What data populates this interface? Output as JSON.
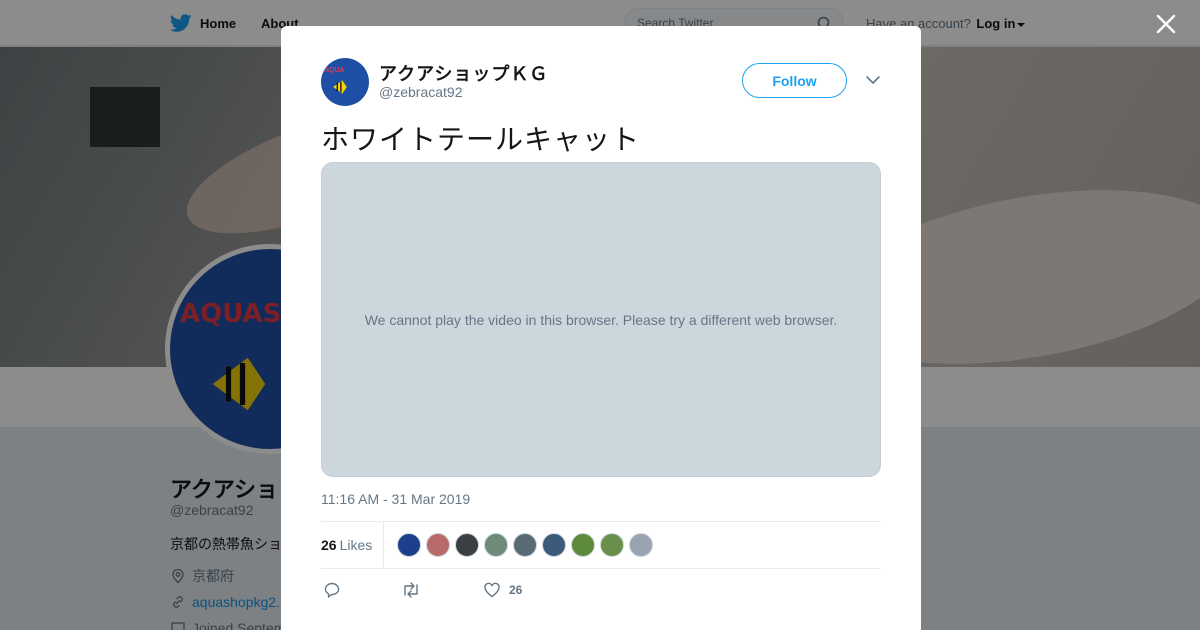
{
  "nav": {
    "home_label": "Home",
    "about_label": "About",
    "search_placeholder": "Search Twitter",
    "account_prompt": "Have an account?",
    "login_label": "Log in"
  },
  "profile": {
    "name": "アクアショップＫＧ",
    "name_truncated": "アクアショ",
    "handle": "@zebracat92",
    "bio_truncated": "京都の熱帯魚ショ",
    "location": "京都府",
    "link_truncated": "aquashopkg2.",
    "joined_truncated": "Joined Septem"
  },
  "modal": {
    "name": "アクアショップＫＧ",
    "handle": "@zebracat92",
    "follow_label": "Follow",
    "tweet_text": "ホワイトテールキャット",
    "video_message": "We cannot play the video in this browser. Please try a different web browser.",
    "timestamp": "11:16 AM - 31 Mar 2019",
    "likes_count": "26",
    "likes_label": "Likes",
    "like_action_count": "26"
  },
  "likers": [
    {
      "color": "#1b3f8a"
    },
    {
      "color": "#b86a6a"
    },
    {
      "color": "#3a3f44"
    },
    {
      "color": "#6e8a7a"
    },
    {
      "color": "#5a6a74"
    },
    {
      "color": "#3d5a7a"
    },
    {
      "color": "#5e8a3c"
    },
    {
      "color": "#6a8f4a"
    },
    {
      "color": "#9aa4b0"
    }
  ],
  "colors": {
    "accent": "#1da1f2",
    "twitter_bird": "#1da1f2",
    "text_primary": "#14171a",
    "text_secondary": "#657786",
    "video_bg": "#ccd6dd"
  }
}
